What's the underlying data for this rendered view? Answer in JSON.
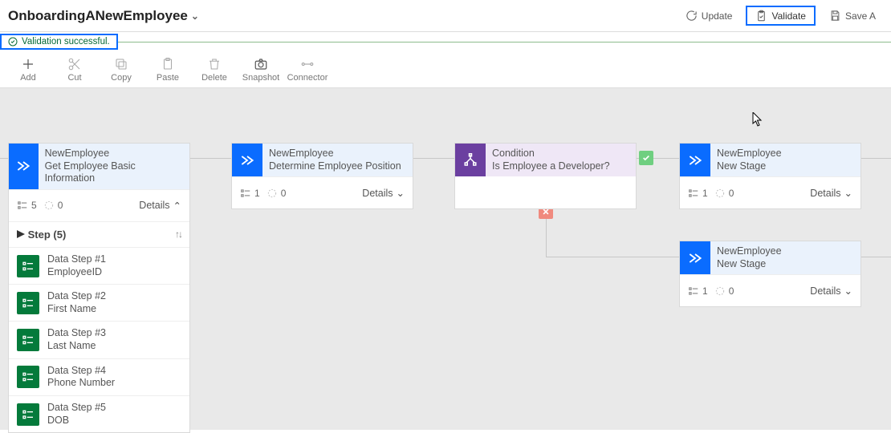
{
  "header": {
    "title": "OnboardingANewEmployee",
    "validation_message": "Validation successful."
  },
  "actions": {
    "update": "Update",
    "validate": "Validate",
    "save": "Save A"
  },
  "toolbar": {
    "add": "Add",
    "cut": "Cut",
    "copy": "Copy",
    "paste": "Paste",
    "delete": "Delete",
    "snapshot": "Snapshot",
    "connector": "Connector"
  },
  "stages": {
    "s1": {
      "entity": "NewEmployee",
      "name": "Get Employee Basic Information",
      "step_count": "5",
      "process_count": "0",
      "details_label": "Details",
      "steps_header": "Step (5)",
      "steps": [
        {
          "title": "Data Step #1",
          "field": "EmployeeID"
        },
        {
          "title": "Data Step #2",
          "field": "First Name"
        },
        {
          "title": "Data Step #3",
          "field": "Last Name"
        },
        {
          "title": "Data Step #4",
          "field": "Phone Number"
        },
        {
          "title": "Data Step #5",
          "field": "DOB"
        }
      ]
    },
    "s2": {
      "entity": "NewEmployee",
      "name": "Determine Employee Position",
      "step_count": "1",
      "process_count": "0",
      "details_label": "Details"
    },
    "cond": {
      "label": "Condition",
      "question": "Is Employee a Developer?"
    },
    "s3": {
      "entity": "NewEmployee",
      "name": "New Stage",
      "step_count": "1",
      "process_count": "0",
      "details_label": "Details"
    },
    "s4": {
      "entity": "NewEmployee",
      "name": "New Stage",
      "step_count": "1",
      "process_count": "0",
      "details_label": "Details"
    }
  },
  "colors": {
    "accent": "#0a6cff",
    "condition": "#6b3fa0",
    "step": "#047a3b",
    "yes": "#6fcf80",
    "no": "#f08a7e"
  }
}
